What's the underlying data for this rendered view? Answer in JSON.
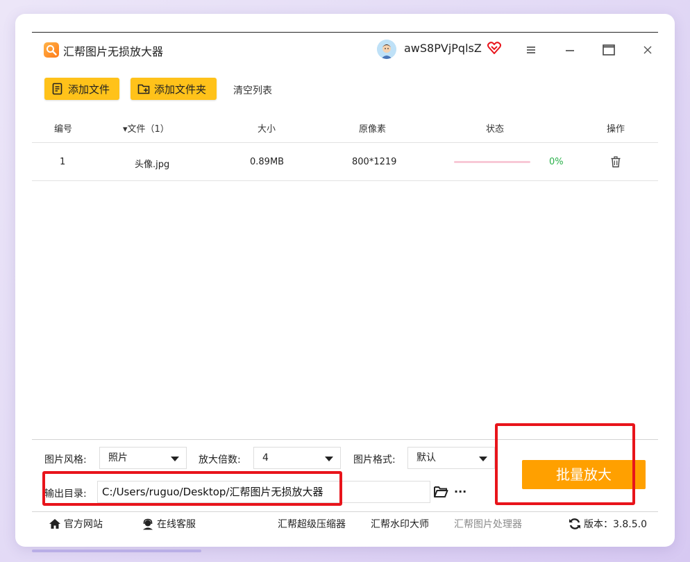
{
  "window": {
    "title": "汇帮图片无损放大器",
    "username": "awS8PVjPqlsZ"
  },
  "toolbar": {
    "add_file": "添加文件",
    "add_folder": "添加文件夹",
    "clear_list": "清空列表"
  },
  "table": {
    "headers": {
      "index": "编号",
      "file": "▾文件（1）",
      "size": "大小",
      "resolution": "原像素",
      "status": "状态",
      "action": "操作"
    },
    "rows": [
      {
        "index": "1",
        "file": "头像.jpg",
        "size": "0.89MB",
        "resolution": "800*1219",
        "progress": 0,
        "progress_text": "0%"
      }
    ]
  },
  "settings": {
    "style_label": "图片风格:",
    "style_value": "照片",
    "scale_label": "放大倍数:",
    "scale_value": "4",
    "format_label": "图片格式:",
    "format_value": "默认",
    "output_label": "输出目录:",
    "output_value": "C:/Users/ruguo/Desktop/汇帮图片无损放大器",
    "batch_button": "批量放大"
  },
  "footer": {
    "website": "官方网站",
    "support": "在线客服",
    "compressor": "汇帮超级压缩器",
    "watermark": "汇帮水印大师",
    "processor": "汇帮图片处理器",
    "version": "版本：3.8.5.0"
  },
  "colors": {
    "accent": "#ffc21a",
    "batch": "#ffa000",
    "highlight": "#e8141b",
    "progress_text": "#2ab04a"
  }
}
